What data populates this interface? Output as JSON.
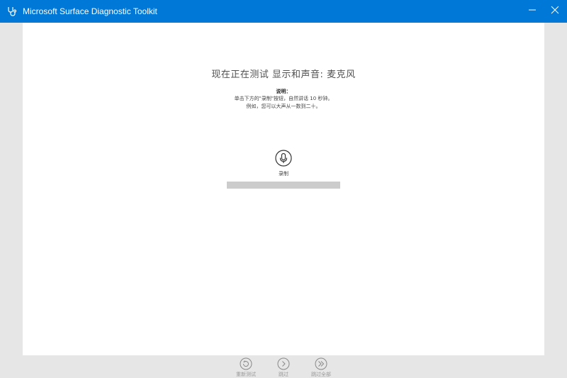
{
  "window": {
    "title": "Microsoft Surface Diagnostic Toolkit",
    "app_icon": "stethoscope-icon",
    "minimize_icon": "minimize-icon",
    "close_icon": "close-icon",
    "accent": "#0078d7"
  },
  "test": {
    "heading": "现在正在测试 显示和声音: 麦克风",
    "instructions_title": "说明：",
    "instructions": [
      "单击下方的\"录制\"按钮，自然讲话 10 秒钟。",
      "例如，您可以大声从一数到二十。"
    ],
    "record_label": "录制",
    "record_icon": "microphone-icon",
    "level": 0
  },
  "footer": {
    "retest_label": "重新测试",
    "skip_label": "跳过",
    "skip_all_label": "跳过全部",
    "retest_icon": "refresh-icon",
    "skip_icon": "chevron-right-icon",
    "skip_all_icon": "double-chevron-right-icon"
  }
}
